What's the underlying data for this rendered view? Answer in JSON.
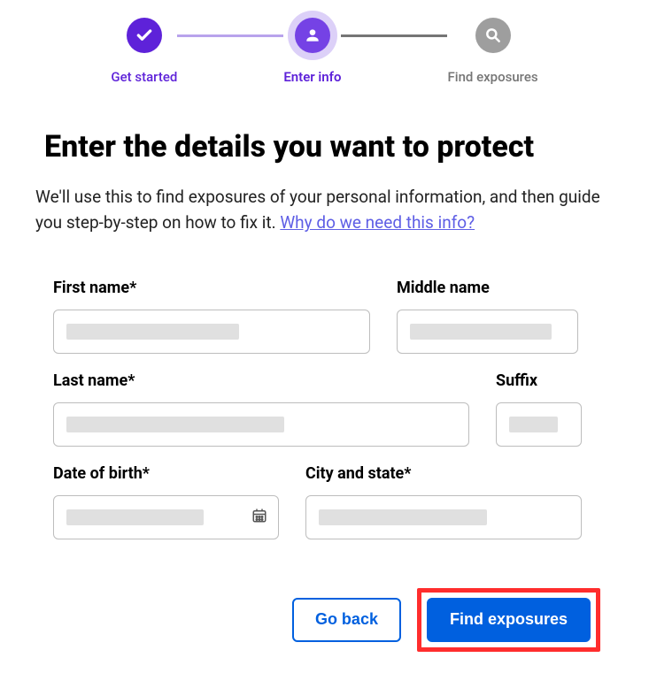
{
  "stepper": {
    "step1": {
      "label": "Get started"
    },
    "step2": {
      "label": "Enter info"
    },
    "step3": {
      "label": "Find exposures"
    }
  },
  "heading": "Enter the details you want to protect",
  "description": "We'll use this to find exposures of your personal information, and then guide you step-by-step on how to fix it. ",
  "info_link": "Why do we need this info?",
  "form": {
    "first_name_label": "First name*",
    "middle_name_label": "Middle name",
    "last_name_label": "Last  name*",
    "suffix_label": "Suffix",
    "dob_label": "Date of birth*",
    "city_label": "City and state*"
  },
  "buttons": {
    "back": "Go back",
    "submit": "Find exposures"
  }
}
